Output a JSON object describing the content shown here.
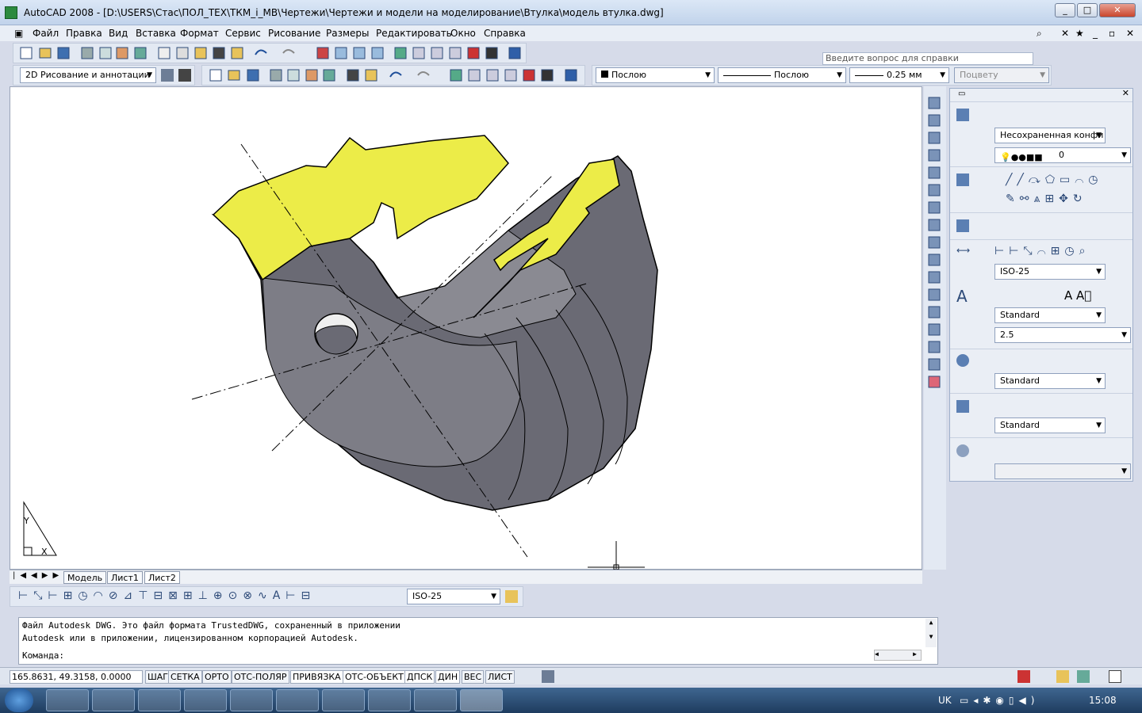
{
  "window": {
    "title": "AutoCAD 2008 - [D:\\USERS\\Стас\\ПОЛ_ТЕХ\\ТКМ_i_МВ\\Чертежи\\Чертежи и модели на моделирование\\Втулка\\модель втулка.dwg]"
  },
  "menu": [
    "Файл",
    "Правка",
    "Вид",
    "Вставка",
    "Формат",
    "Сервис",
    "Рисование",
    "Размеры",
    "Редактировать",
    "Окно",
    "Справка"
  ],
  "help": {
    "placeholder": "Введите вопрос для справки"
  },
  "toolbar": {
    "workspace": "2D Рисование и аннотации",
    "color": "Послою",
    "linetype": "Послою",
    "lineweight": "0.25 мм",
    "plotstyle": "Поцвету"
  },
  "panel": {
    "layer_state": "Несохраненная конфи",
    "layer": "0",
    "dim_style": "ISO-25",
    "text_style": "Standard",
    "text_height": "2.5",
    "multileader_style": "Standard",
    "table_style": "Standard"
  },
  "ucs": {
    "y": "Y",
    "x": "X"
  },
  "tabs": [
    "Модель",
    "Лист1",
    "Лист2"
  ],
  "dimbar": {
    "style": "ISO-25"
  },
  "command": {
    "line1": "Файл Autodesk DWG. Это файл формата TrustedDWG, сохраненный в приложении",
    "line2": "Autodesk или в приложении, лицензированном корпорацией Autodesk.",
    "prompt": "Команда:"
  },
  "status": {
    "coords": "165.8631, 49.3158, 0.0000",
    "buttons": [
      "ШАГ",
      "СЕТКА",
      "ОРТО",
      "ОТС-ПОЛЯР",
      "ПРИВЯЗКА",
      "ОТС-ОБЪЕКТ",
      "ДПСК",
      "ДИН",
      "ВЕС",
      "ЛИСТ"
    ]
  },
  "taskbar": {
    "lang": "UK",
    "time": "15:08"
  },
  "colors": {
    "section": "#ecec48",
    "body": "#6a6a74"
  }
}
